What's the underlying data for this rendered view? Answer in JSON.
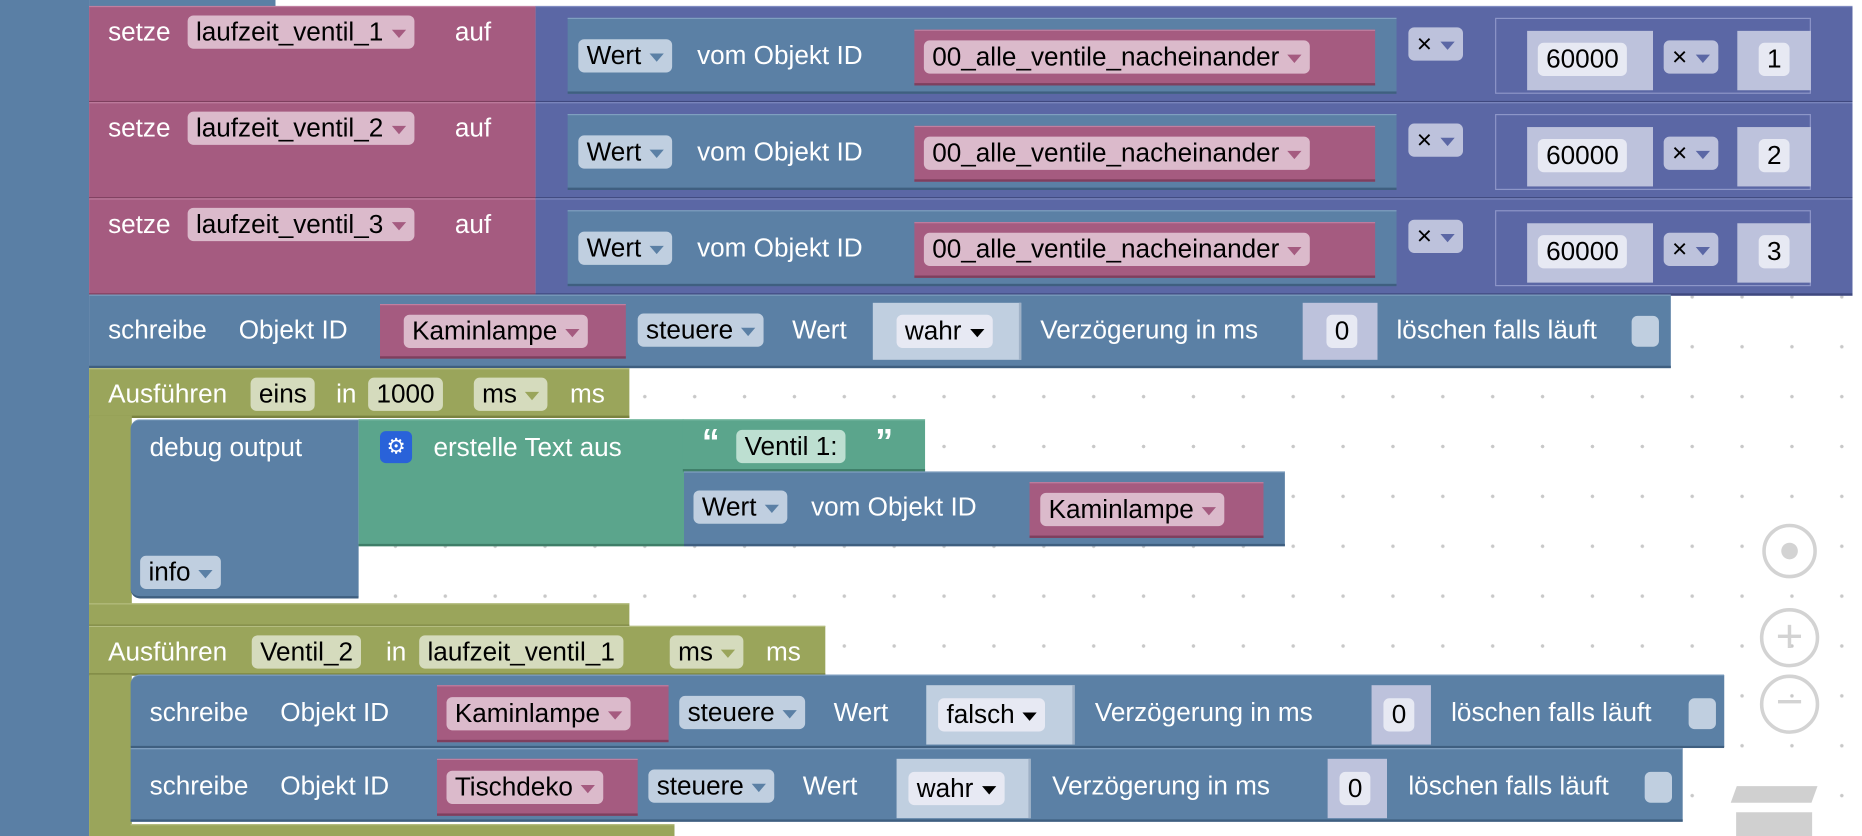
{
  "set_rows": [
    {
      "keyword": "setze",
      "variable": "laufzeit_ventil_1",
      "to": "auf",
      "value_dropdown": "Wert",
      "of_object": "vom Objekt ID",
      "object": "00_alle_ventile_nacheinander",
      "op1": "×",
      "number": "60000",
      "op2": "×",
      "factor": "1"
    },
    {
      "keyword": "setze",
      "variable": "laufzeit_ventil_2",
      "to": "auf",
      "value_dropdown": "Wert",
      "of_object": "vom Objekt ID",
      "object": "00_alle_ventile_nacheinander",
      "op1": "×",
      "number": "60000",
      "op2": "×",
      "factor": "2"
    },
    {
      "keyword": "setze",
      "variable": "laufzeit_ventil_3",
      "to": "auf",
      "value_dropdown": "Wert",
      "of_object": "vom Objekt ID",
      "object": "00_alle_ventile_nacheinander",
      "op1": "×",
      "number": "60000",
      "op2": "×",
      "factor": "3"
    }
  ],
  "write1": {
    "keyword": "schreibe",
    "object_label": "Objekt ID",
    "object": "Kaminlampe",
    "mode": "steuere",
    "value_label": "Wert",
    "value": "wahr",
    "delay_label": "Verzögerung in ms",
    "delay": "0",
    "clear_label": "löschen falls läuft",
    "clear_checked": false
  },
  "timeout1": {
    "keyword": "Ausführen",
    "name": "eins",
    "in": "in",
    "duration": "1000",
    "unit_dropdown": "ms",
    "unit": "ms",
    "debug": {
      "label": "debug output",
      "level": "info",
      "join_label": "erstelle Text aus",
      "text": "Ventil 1:",
      "quote_open": "“",
      "quote_close": "”",
      "value_dropdown": "Wert",
      "of_object": "vom Objekt ID",
      "object": "Kaminlampe"
    }
  },
  "timeout2": {
    "keyword": "Ausführen",
    "name": "Ventil_2",
    "in": "in",
    "duration": "laufzeit_ventil_1",
    "unit_dropdown": "ms",
    "unit": "ms",
    "writes": [
      {
        "keyword": "schreibe",
        "object_label": "Objekt ID",
        "object": "Kaminlampe",
        "mode": "steuere",
        "value_label": "Wert",
        "value": "falsch",
        "delay_label": "Verzögerung in ms",
        "delay": "0",
        "clear_label": "löschen falls läuft",
        "clear_checked": false
      },
      {
        "keyword": "schreibe",
        "object_label": "Objekt ID",
        "object": "Tischdeko",
        "mode": "steuere",
        "value_label": "Wert",
        "value": "wahr",
        "delay_label": "Verzögerung in ms",
        "delay": "0",
        "clear_label": "löschen falls läuft",
        "clear_checked": false
      }
    ]
  },
  "controls": {
    "icons": [
      "recenter-icon",
      "zoom-in-icon",
      "zoom-out-icon",
      "trash-icon"
    ]
  },
  "colors": {
    "variables": "#a55b80",
    "objects": "#5b80a5",
    "math": "#5b67a5",
    "timeouts": "#9aa55b",
    "text": "#5ba58c"
  }
}
